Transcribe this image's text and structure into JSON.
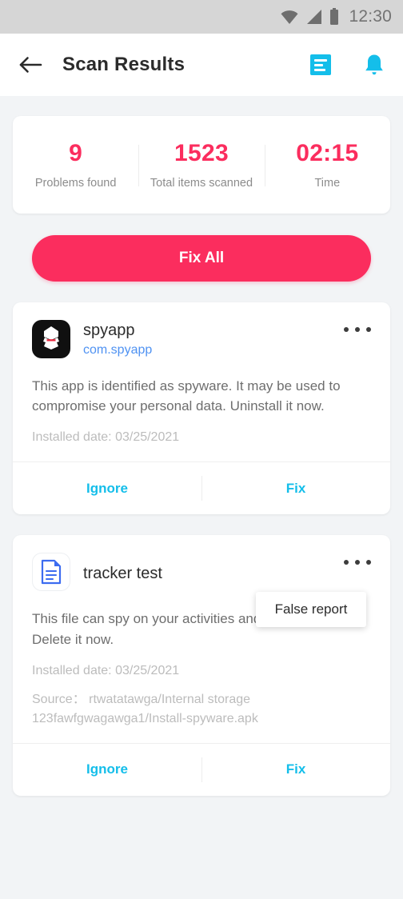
{
  "status_bar": {
    "time": "12:30",
    "icons": [
      "wifi-icon",
      "cellular-signal-icon",
      "battery-icon"
    ]
  },
  "app_bar": {
    "title": "Scan Results",
    "back_icon": "back-arrow-icon",
    "actions": [
      {
        "name": "report-icon"
      },
      {
        "name": "notification-bell-icon"
      }
    ]
  },
  "stats": [
    {
      "value": "9",
      "label": "Problems found"
    },
    {
      "value": "1523",
      "label": "Total items scanned"
    },
    {
      "value": "02:15",
      "label": "Time"
    }
  ],
  "fix_all": {
    "label": "Fix All"
  },
  "threats": [
    {
      "icon": "spyware-app-icon",
      "title": "spyapp",
      "package": "com.spyapp",
      "description": "This app is identified as spyware. It may be used to compromise your personal data. Uninstall it now.",
      "installed_date": "Installed date: 03/25/2021",
      "source": null,
      "ignore_label": "Ignore",
      "fix_label": "Fix",
      "menu_icon": "overflow-menu-icon"
    },
    {
      "icon": "document-file-icon",
      "title": "tracker test",
      "package": null,
      "description": "This file can spy on your activities and/or location. Delete it now.",
      "installed_date": "Installed date: 03/25/2021",
      "source": "Source： rtwatatawga/Internal storage 123fawfgwagawga1/Install-spyware.apk",
      "ignore_label": "Ignore",
      "fix_label": "Fix",
      "menu_icon": "overflow-menu-icon"
    }
  ],
  "popup_menu": {
    "items": [
      "False report"
    ],
    "visible_item": "False report"
  },
  "colors": {
    "accent_pink": "#FB2D5E",
    "accent_cyan": "#14BEEA",
    "link_blue": "#4F92F2",
    "page_background": "#F2F4F6",
    "card_background": "#FFFFFF",
    "status_bar_background": "#D6D6D6"
  }
}
